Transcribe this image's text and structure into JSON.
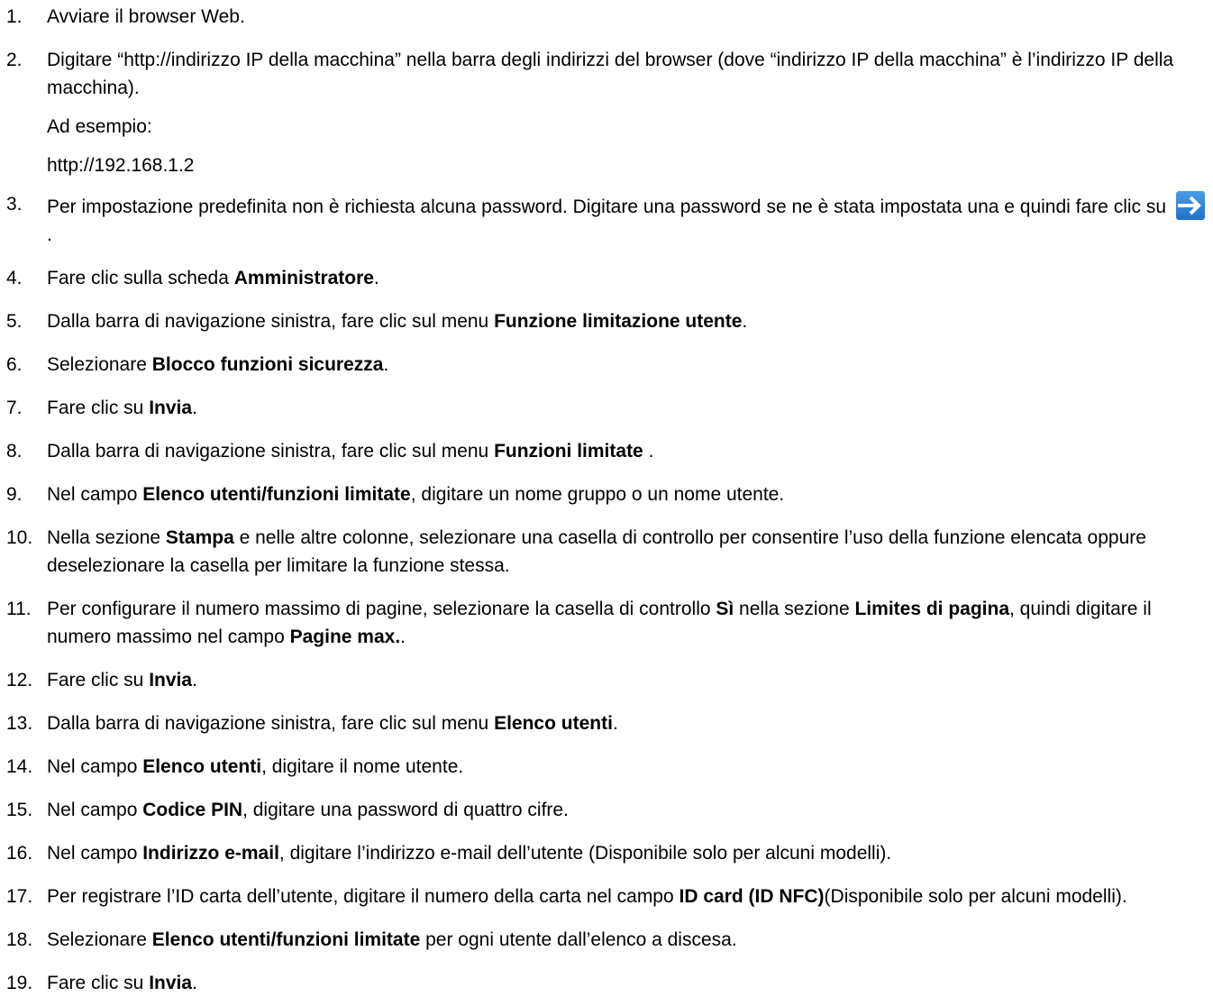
{
  "steps": [
    {
      "num": "1.",
      "parts": [
        {
          "t": "Avviare il browser Web."
        }
      ]
    },
    {
      "num": "2.",
      "parts": [
        {
          "t": "Digitare “http://indirizzo IP della macchina” nella barra degli indirizzi del browser (dove “indirizzo IP della macchina” è l’indirizzo IP della macchina)."
        }
      ],
      "subs": [
        "Ad esempio:",
        "http://192.168.1.2"
      ]
    },
    {
      "num": "3.",
      "parts": [
        {
          "t": "Per impostazione predefinita non è richiesta alcuna password. Digitare una password se ne è stata impostata una e quindi fare clic su "
        },
        {
          "icon": "arrow-right-icon"
        },
        {
          "t": "."
        }
      ]
    },
    {
      "num": "4.",
      "parts": [
        {
          "t": "Fare clic sulla scheda "
        },
        {
          "b": "Amministratore"
        },
        {
          "t": "."
        }
      ]
    },
    {
      "num": "5.",
      "parts": [
        {
          "t": "Dalla barra di navigazione sinistra, fare clic sul menu "
        },
        {
          "b": "Funzione limitazione utente"
        },
        {
          "t": "."
        }
      ]
    },
    {
      "num": "6.",
      "parts": [
        {
          "t": "Selezionare "
        },
        {
          "b": "Blocco funzioni sicurezza"
        },
        {
          "t": "."
        }
      ]
    },
    {
      "num": "7.",
      "parts": [
        {
          "t": "Fare clic su "
        },
        {
          "b": "Invia"
        },
        {
          "t": "."
        }
      ]
    },
    {
      "num": "8.",
      "parts": [
        {
          "t": "Dalla barra di navigazione sinistra, fare clic sul menu "
        },
        {
          "b": "Funzioni limitate"
        },
        {
          "t": " ."
        }
      ]
    },
    {
      "num": "9.",
      "parts": [
        {
          "t": "Nel campo "
        },
        {
          "b": "Elenco utenti/funzioni limitate"
        },
        {
          "t": ", digitare un nome gruppo o un nome utente."
        }
      ]
    },
    {
      "num": "10.",
      "parts": [
        {
          "t": "Nella sezione "
        },
        {
          "b": "Stampa"
        },
        {
          "t": " e nelle altre colonne, selezionare una casella di controllo per consentire l’uso della funzione elencata oppure deselezionare la casella per limitare la funzione stessa."
        }
      ]
    },
    {
      "num": "11.",
      "parts": [
        {
          "t": "Per configurare il numero massimo di pagine, selezionare la casella di controllo "
        },
        {
          "b": "Sì"
        },
        {
          "t": " nella sezione "
        },
        {
          "b": "Limites di pagina"
        },
        {
          "t": ", quindi digitare il numero massimo nel campo "
        },
        {
          "b": "Pagine max."
        },
        {
          "t": "."
        }
      ]
    },
    {
      "num": "12.",
      "parts": [
        {
          "t": "Fare clic su "
        },
        {
          "b": "Invia"
        },
        {
          "t": "."
        }
      ]
    },
    {
      "num": "13.",
      "parts": [
        {
          "t": "Dalla barra di navigazione sinistra, fare clic sul menu "
        },
        {
          "b": "Elenco utenti"
        },
        {
          "t": "."
        }
      ]
    },
    {
      "num": "14.",
      "parts": [
        {
          "t": "Nel campo "
        },
        {
          "b": "Elenco utenti"
        },
        {
          "t": ", digitare il nome utente."
        }
      ]
    },
    {
      "num": "15.",
      "parts": [
        {
          "t": "Nel campo "
        },
        {
          "b": "Codice PIN"
        },
        {
          "t": ", digitare una password di quattro cifre."
        }
      ]
    },
    {
      "num": "16.",
      "parts": [
        {
          "t": "Nel campo "
        },
        {
          "b": "Indirizzo e-mail"
        },
        {
          "t": ", digitare l’indirizzo e-mail dell’utente (Disponibile solo per alcuni modelli)."
        }
      ]
    },
    {
      "num": "17.",
      "parts": [
        {
          "t": "Per registrare l’ID carta dell’utente, digitare il numero della carta nel campo "
        },
        {
          "b": "ID card (ID NFC)"
        },
        {
          "t": "(Disponibile solo per alcuni modelli)."
        }
      ]
    },
    {
      "num": "18.",
      "parts": [
        {
          "t": "Selezionare "
        },
        {
          "b": "Elenco utenti/funzioni limitate"
        },
        {
          "t": " per ogni utente dall’elenco a discesa."
        }
      ]
    },
    {
      "num": "19.",
      "parts": [
        {
          "t": "Fare clic su "
        },
        {
          "b": "Invia"
        },
        {
          "t": "."
        }
      ]
    }
  ],
  "colors": {
    "arrow_icon_bg": "#1f72c8",
    "arrow_icon_fg": "#ffffff"
  }
}
